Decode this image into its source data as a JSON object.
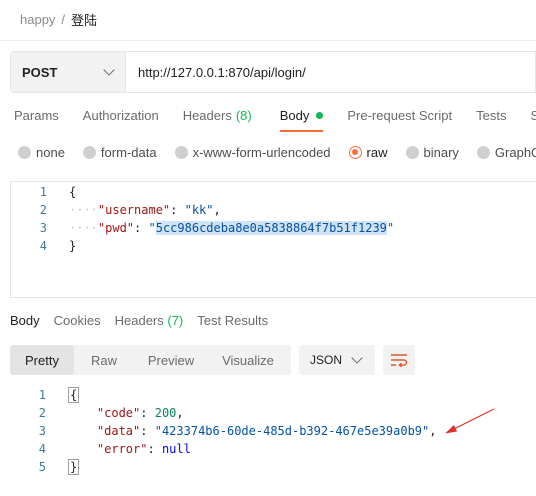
{
  "breadcrumb": {
    "parent": "happy",
    "separator": "/",
    "current": "登陆"
  },
  "request": {
    "method": "POST",
    "url": "http://127.0.0.1:870/api/login/"
  },
  "request_tabs": [
    {
      "label": "Params"
    },
    {
      "label": "Authorization"
    },
    {
      "label": "Headers",
      "count": "(8)"
    },
    {
      "label": "Body"
    },
    {
      "label": "Pre-request Script"
    },
    {
      "label": "Tests"
    },
    {
      "label": "Se"
    }
  ],
  "body_modes": [
    "none",
    "form-data",
    "x-www-form-urlencoded",
    "raw",
    "binary",
    "GraphQL"
  ],
  "request_body": {
    "line_numbers": [
      "1",
      "2",
      "3",
      "4"
    ],
    "open_brace": "{",
    "close_brace": "}",
    "dots": "····",
    "key1": "\"username\"",
    "val1": "\"kk\"",
    "key2": "\"pwd\"",
    "val2": "5cc986cdeba8e0a5838864f7b51f1239",
    "colon": ": ",
    "comma": ",",
    "quote": "\""
  },
  "response_tabs": [
    {
      "label": "Body"
    },
    {
      "label": "Cookies"
    },
    {
      "label": "Headers",
      "count": "(7)"
    },
    {
      "label": "Test Results"
    }
  ],
  "view_modes": [
    "Pretty",
    "Raw",
    "Preview",
    "Visualize"
  ],
  "format": "JSON",
  "response_body": {
    "line_numbers": [
      "1",
      "2",
      "3",
      "4",
      "5"
    ],
    "open_brace": "{",
    "close_brace": "}",
    "indent": "    ",
    "key1": "\"code\"",
    "val1": "200",
    "key2": "\"data\"",
    "val2": "\"423374b6-60de-485d-b392-467e5e39a0b9\"",
    "key3": "\"error\"",
    "val3": "null",
    "colon": ": ",
    "comma": ","
  },
  "colors": {
    "accent": "#ff6c37",
    "success": "#0cbb52",
    "annotation": "#e0312f"
  }
}
